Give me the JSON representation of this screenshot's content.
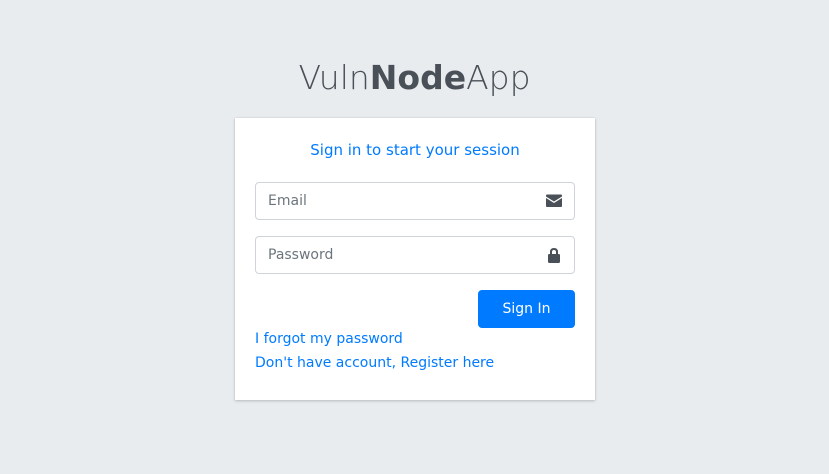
{
  "logo": {
    "part1": "Vuln",
    "part2": "Node",
    "part3": "App"
  },
  "login": {
    "message": "Sign in to start your session",
    "email_placeholder": "Email",
    "email_value": "",
    "password_placeholder": "Password",
    "password_value": "",
    "signin_label": "Sign In",
    "forgot_label": "I forgot my password",
    "register_label": "Don't have account, Register here"
  },
  "icons": {
    "email": "envelope-icon",
    "password": "lock-icon"
  },
  "colors": {
    "background": "#e9ecef",
    "primary": "#007bff",
    "icon": "#495057"
  }
}
